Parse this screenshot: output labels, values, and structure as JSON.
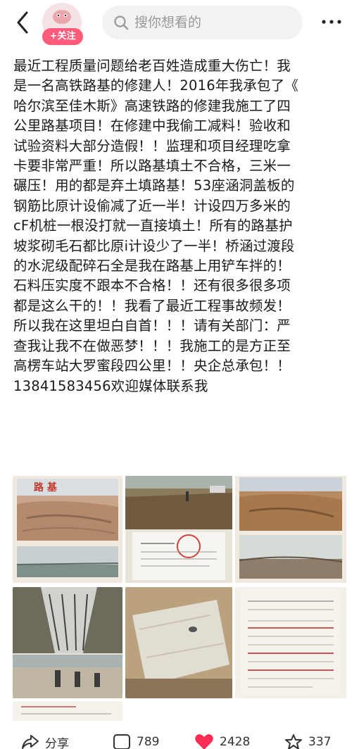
{
  "header": {
    "follow_label": "+关注",
    "search_placeholder": "搜你想看的"
  },
  "post": {
    "lines": [
      "最近工程质量问题给老百姓造成重大伤亡！我",
      "是一名高铁路基的修建人！2016年我承包了《",
      "哈尔滨至佳木斯》高速铁路的修建我施工了四",
      "公里路基项目！在修建中我偷工减料！验收和",
      "试验资料大部分造假！！监理和项目经理吃拿",
      "卡要非常严重！所以路基填土不合格，三米一",
      "碾压！用的都是弃土填路基！53座涵洞盖板的",
      "钢筋比原计设偷减了近一半！计设四万多米的",
      "cF机桩一根没打就一直接填土！所有的路基护",
      "坡浆砌毛石都比原i计设少了一半！桥涵过渡段",
      "的水泥级配碎石全是我在路基上用铲车拌的！",
      "石料压实度不跟本不合格！！还有很多很多项",
      "都是这么干的！！我看了最近工程事故频发！",
      "所以我在这里坦白自首！！！请有关部门：严",
      "查我让我不在做恶梦！！！我施工的是方正至",
      "高楞车站大罗蜜段四公里！！央企总承包！！",
      "13841583456欢迎媒体联系我"
    ]
  },
  "photos": {
    "p1_caption": "路 基"
  },
  "actions": {
    "share_label": "分享",
    "comments_count": "789",
    "likes_count": "2428",
    "favorites_count": "337"
  },
  "colors": {
    "accent": "#ff5c7c",
    "like": "#ff2d55",
    "text": "#1a1a1a"
  }
}
